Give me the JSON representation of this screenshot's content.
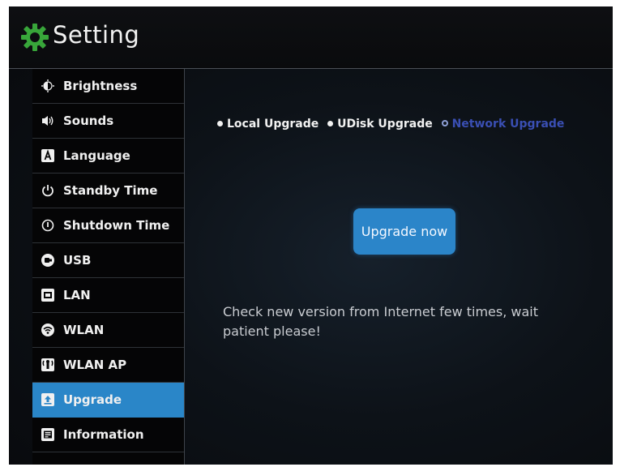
{
  "header": {
    "title": "Setting",
    "icon": "gear-icon",
    "icon_color": "#38a63a"
  },
  "sidebar": {
    "items": [
      {
        "label": "Brightness",
        "icon": "brightness-icon",
        "active": false
      },
      {
        "label": "Sounds",
        "icon": "speaker-icon",
        "active": false
      },
      {
        "label": "Language",
        "icon": "language-icon",
        "active": false
      },
      {
        "label": "Standby Time",
        "icon": "power-icon",
        "active": false
      },
      {
        "label": "Shutdown Time",
        "icon": "shutdown-icon",
        "active": false
      },
      {
        "label": "USB",
        "icon": "usb-icon",
        "active": false
      },
      {
        "label": "LAN",
        "icon": "lan-icon",
        "active": false
      },
      {
        "label": "WLAN",
        "icon": "wifi-icon",
        "active": false
      },
      {
        "label": "WLAN AP",
        "icon": "access-point-icon",
        "active": false
      },
      {
        "label": "Upgrade",
        "icon": "upgrade-icon",
        "active": true
      },
      {
        "label": "Information",
        "icon": "information-icon",
        "active": false
      }
    ],
    "active_color": "#2a86c8"
  },
  "main": {
    "tabs": [
      {
        "label": "Local Upgrade",
        "selected": false
      },
      {
        "label": "UDisk Upgrade",
        "selected": false
      },
      {
        "label": "Network Upgrade",
        "selected": true
      }
    ],
    "upgrade_button": "Upgrade now",
    "message": "Check new version from Internet few times, wait patient please!"
  }
}
